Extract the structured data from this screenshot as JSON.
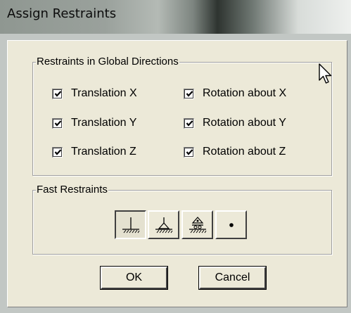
{
  "window": {
    "title": "Assign Restraints"
  },
  "restraints_group": {
    "label": "Restraints in Global Directions",
    "checkboxes": [
      {
        "label": "Translation X",
        "checked": true
      },
      {
        "label": "Rotation about X",
        "checked": true
      },
      {
        "label": "Translation Y",
        "checked": true
      },
      {
        "label": "Rotation about Y",
        "checked": true
      },
      {
        "label": "Translation Z",
        "checked": true
      },
      {
        "label": "Rotation about Z",
        "checked": true
      }
    ]
  },
  "fast_group": {
    "label": "Fast Restraints",
    "buttons": [
      {
        "icon": "fixed-support-icon",
        "pressed": true
      },
      {
        "icon": "pinned-support-icon",
        "pressed": false
      },
      {
        "icon": "roller-support-icon",
        "pressed": false
      },
      {
        "icon": "free-joint-icon",
        "pressed": false
      }
    ]
  },
  "buttons": {
    "ok": "OK",
    "cancel": "Cancel"
  },
  "colors": {
    "dialog_bg": "#ece9d8",
    "frame": "#c2c7c4"
  }
}
